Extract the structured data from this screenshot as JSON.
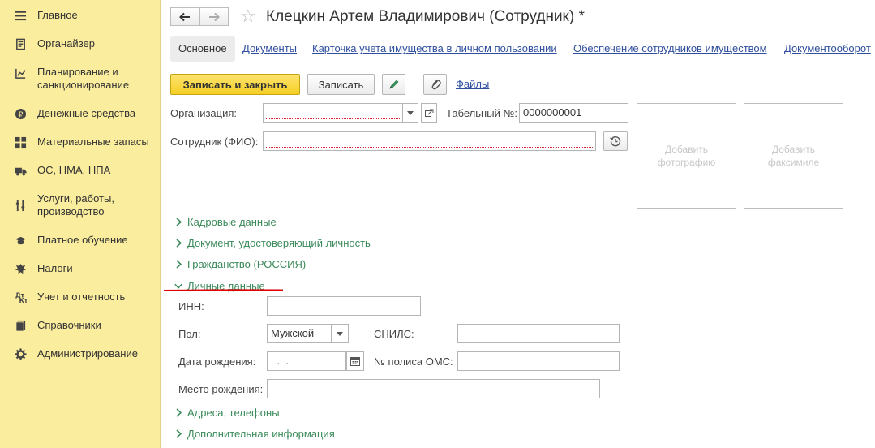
{
  "sidebar": {
    "items": [
      {
        "label": "Главное",
        "icon": "menu-icon"
      },
      {
        "label": "Органайзер",
        "icon": "organizer-icon"
      },
      {
        "label": "Планирование и санкционирование",
        "icon": "planning-icon"
      },
      {
        "label": "Денежные средства",
        "icon": "money-icon"
      },
      {
        "label": "Материальные запасы",
        "icon": "inventory-icon"
      },
      {
        "label": "ОС, НМА, НПА",
        "icon": "truck-icon"
      },
      {
        "label": "Услуги, работы, производство",
        "icon": "services-icon"
      },
      {
        "label": "Платное обучение",
        "icon": "education-icon"
      },
      {
        "label": "Налоги",
        "icon": "taxes-icon"
      },
      {
        "label": "Учет и отчетность",
        "icon": "accounting-icon"
      },
      {
        "label": "Справочники",
        "icon": "catalogs-icon"
      },
      {
        "label": "Администрирование",
        "icon": "gear-icon"
      }
    ]
  },
  "header": {
    "title": "Клецкин Артем Владимирович (Сотрудник) *"
  },
  "tabs": [
    {
      "label": "Основное",
      "active": true
    },
    {
      "label": "Документы"
    },
    {
      "label": "Карточка учета имущества в личном пользовании"
    },
    {
      "label": "Обеспечение сотрудников имуществом"
    },
    {
      "label": "Документооборот"
    }
  ],
  "toolbar": {
    "save_close_label": "Записать и закрыть",
    "save_label": "Записать",
    "files_label": "Файлы"
  },
  "form": {
    "organization_label": "Организация:",
    "organization_value": "",
    "tab_number_label": "Табельный №:",
    "tab_number_value": "0000000001",
    "employee_label": "Сотрудник (ФИО):",
    "employee_value": "",
    "add_photo": "Добавить фотографию",
    "add_facsimile": "Добавить факсимиле"
  },
  "sections": {
    "hr": "Кадровые данные",
    "identity": "Документ, удостоверяющий личность",
    "citizenship": "Гражданство (РОССИЯ)",
    "personal": "Личные данные",
    "addresses": "Адреса, телефоны",
    "additional": "Дополнительная информация"
  },
  "personal": {
    "inn_label": "ИНН:",
    "inn_value": "",
    "gender_label": "Пол:",
    "gender_value": "Мужской",
    "snils_label": "СНИЛС:",
    "snils_value": "   -    -",
    "birthdate_label": "Дата рождения:",
    "birthdate_value": " .  .",
    "oms_label": "№ полиса ОМС:",
    "oms_value": "",
    "birthplace_label": "Место рождения:",
    "birthplace_value": ""
  },
  "colors": {
    "sidebar_bg": "#fbed9e",
    "primary_button": "#f6cf24",
    "link": "#2f4f9e",
    "section": "#3a8a5a",
    "required_underline": "#d23",
    "annotation_red": "#e00000"
  }
}
